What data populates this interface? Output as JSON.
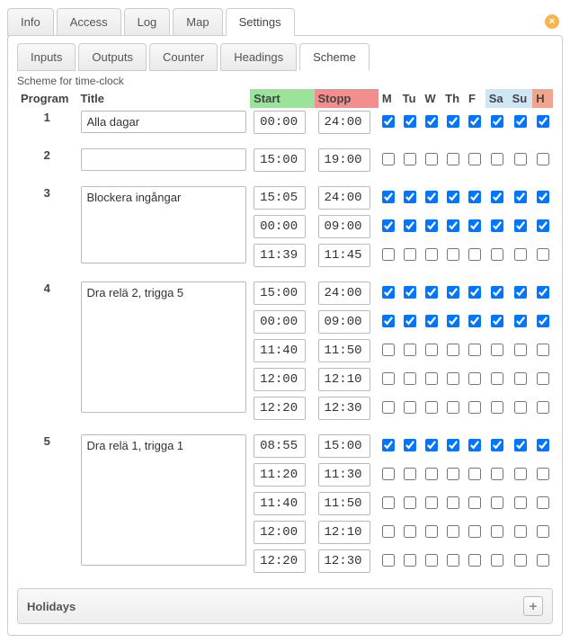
{
  "mainTabs": [
    "Info",
    "Access",
    "Log",
    "Map",
    "Settings"
  ],
  "mainActive": 4,
  "closeGlyph": "×",
  "subTabs": [
    "Inputs",
    "Outputs",
    "Counter",
    "Headings",
    "Scheme"
  ],
  "subActive": 4,
  "schemeLabel": "Scheme for time-clock",
  "cols": {
    "program": "Program",
    "title": "Title",
    "start": "Start",
    "stopp": "Stopp",
    "days": [
      "M",
      "Tu",
      "W",
      "Th",
      "F",
      "Sa",
      "Su",
      "H"
    ]
  },
  "programs": [
    {
      "num": "1",
      "title": "Alla dagar",
      "rows": [
        {
          "start": "00:00",
          "stopp": "24:00",
          "days": [
            true,
            true,
            true,
            true,
            true,
            true,
            true,
            true
          ]
        }
      ]
    },
    {
      "num": "2",
      "title": "",
      "rows": [
        {
          "start": "15:00",
          "stopp": "19:00",
          "days": [
            false,
            false,
            false,
            false,
            false,
            false,
            false,
            false
          ]
        }
      ]
    },
    {
      "num": "3",
      "title": "Blockera ingångar",
      "rows": [
        {
          "start": "15:05",
          "stopp": "24:00",
          "days": [
            true,
            true,
            true,
            true,
            true,
            true,
            true,
            true
          ]
        },
        {
          "start": "00:00",
          "stopp": "09:00",
          "days": [
            true,
            true,
            true,
            true,
            true,
            true,
            true,
            true
          ]
        },
        {
          "start": "11:39",
          "stopp": "11:45",
          "days": [
            false,
            false,
            false,
            false,
            false,
            false,
            false,
            false
          ]
        }
      ]
    },
    {
      "num": "4",
      "title": "Dra relä 2, trigga 5",
      "rows": [
        {
          "start": "15:00",
          "stopp": "24:00",
          "days": [
            true,
            true,
            true,
            true,
            true,
            true,
            true,
            true
          ]
        },
        {
          "start": "00:00",
          "stopp": "09:00",
          "days": [
            true,
            true,
            true,
            true,
            true,
            true,
            true,
            true
          ]
        },
        {
          "start": "11:40",
          "stopp": "11:50",
          "days": [
            false,
            false,
            false,
            false,
            false,
            false,
            false,
            false
          ]
        },
        {
          "start": "12:00",
          "stopp": "12:10",
          "days": [
            false,
            false,
            false,
            false,
            false,
            false,
            false,
            false
          ]
        },
        {
          "start": "12:20",
          "stopp": "12:30",
          "days": [
            false,
            false,
            false,
            false,
            false,
            false,
            false,
            false
          ]
        }
      ]
    },
    {
      "num": "5",
      "title": "Dra relä 1, trigga 1",
      "rows": [
        {
          "start": "08:55",
          "stopp": "15:00",
          "days": [
            true,
            true,
            true,
            true,
            true,
            true,
            true,
            true
          ]
        },
        {
          "start": "11:20",
          "stopp": "11:30",
          "days": [
            false,
            false,
            false,
            false,
            false,
            false,
            false,
            false
          ]
        },
        {
          "start": "11:40",
          "stopp": "11:50",
          "days": [
            false,
            false,
            false,
            false,
            false,
            false,
            false,
            false
          ]
        },
        {
          "start": "12:00",
          "stopp": "12:10",
          "days": [
            false,
            false,
            false,
            false,
            false,
            false,
            false,
            false
          ]
        },
        {
          "start": "12:20",
          "stopp": "12:30",
          "days": [
            false,
            false,
            false,
            false,
            false,
            false,
            false,
            false
          ]
        }
      ]
    }
  ],
  "holidays": {
    "label": "Holidays",
    "addGlyph": "+"
  }
}
